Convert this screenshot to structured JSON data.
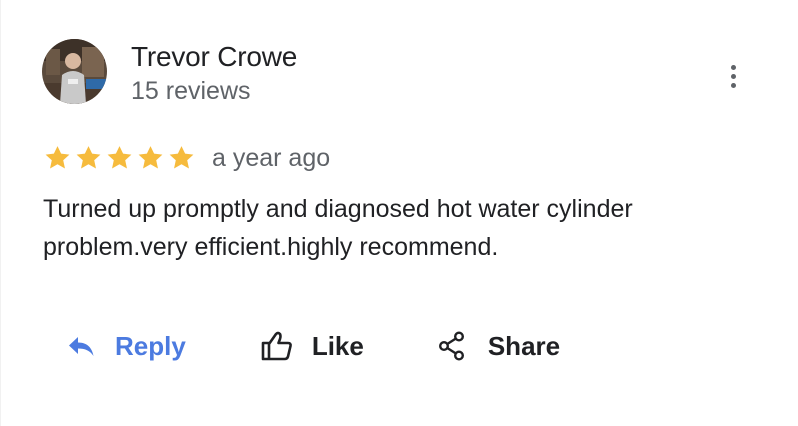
{
  "review": {
    "author_name": "Trevor Crowe",
    "review_count": "15 reviews",
    "rating": 5,
    "rating_max": 5,
    "time": "a year ago",
    "text": "Turned up promptly and diagnosed hot water cylinder problem.very efficient.highly recommend."
  },
  "actions": {
    "reply_label": "Reply",
    "like_label": "Like",
    "share_label": "Share"
  },
  "icons": {
    "avatar": "profile-photo",
    "more": "more-vert-icon",
    "star": "star-icon",
    "reply": "reply-arrow-icon",
    "like": "thumb-up-icon",
    "share": "share-icon"
  },
  "colors": {
    "star": "#f6bb3d",
    "reply": "#4c7be0",
    "secondary_text": "#5f6368",
    "primary_text": "#202124"
  }
}
